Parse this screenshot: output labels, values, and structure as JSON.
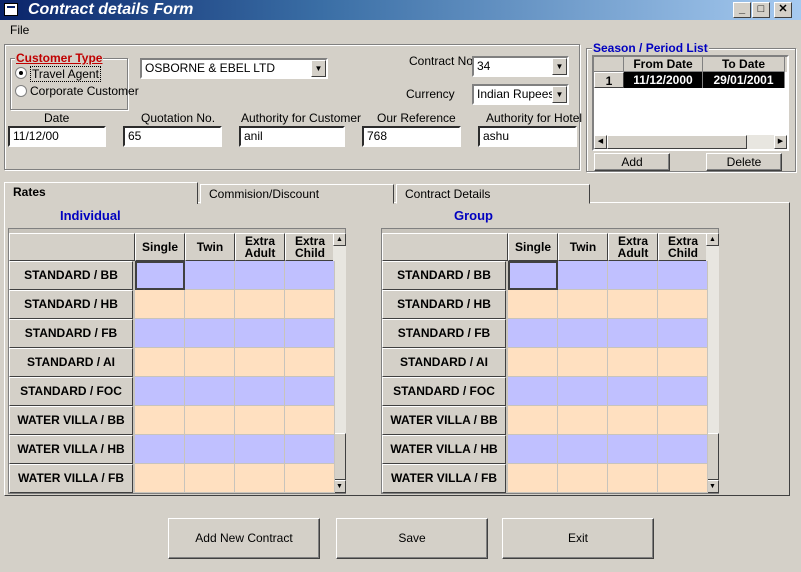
{
  "window": {
    "title": "Contract details Form",
    "min": "_",
    "max": "□",
    "close": "✕"
  },
  "menu": {
    "file": "File"
  },
  "customer_type": {
    "label": "Customer Type",
    "options": [
      "Travel Agent",
      "Corporate Customer"
    ],
    "selected": "Travel Agent"
  },
  "customer_name": "OSBORNE & EBEL LTD",
  "contract_no": {
    "label": "Contract No.",
    "value": "34"
  },
  "currency": {
    "label": "Currency",
    "value": "Indian Rupees"
  },
  "fields": {
    "date": {
      "label": "Date",
      "value": "11/12/00"
    },
    "quotation": {
      "label": "Quotation No.",
      "value": "65"
    },
    "authority_customer": {
      "label": "Authority for Customer",
      "value": "anil"
    },
    "our_reference": {
      "label": "Our Reference",
      "value": "768"
    },
    "authority_hotel": {
      "label": "Authority for Hotel",
      "value": "ashu"
    }
  },
  "season": {
    "label": "Season / Period List",
    "headers": [
      "From Date",
      "To Date"
    ],
    "rows": [
      {
        "index": "1",
        "from": "11/12/2000",
        "to": "29/01/2001"
      }
    ],
    "add": "Add",
    "delete": "Delete"
  },
  "tabs": [
    "Rates",
    "Commision/Discount",
    "Contract Details"
  ],
  "individual": {
    "title": "Individual"
  },
  "group": {
    "title": "Group"
  },
  "rate_columns": [
    [
      "Single"
    ],
    [
      "Twin"
    ],
    [
      "Extra",
      "Adult"
    ],
    [
      "Extra",
      "Child"
    ]
  ],
  "rate_rows": [
    "STANDARD / BB",
    "STANDARD / HB",
    "STANDARD / FB",
    "STANDARD / AI",
    "STANDARD / FOC",
    "WATER VILLA / BB",
    "WATER VILLA / HB",
    "WATER VILLA / FB"
  ],
  "actions": {
    "add_new": "Add New Contract",
    "save": "Save",
    "exit": "Exit"
  },
  "colors": {
    "row_blue": "#c0c0ff",
    "row_peach": "#ffe0c0",
    "accent": "#0000c0",
    "label_red": "#c00000"
  }
}
